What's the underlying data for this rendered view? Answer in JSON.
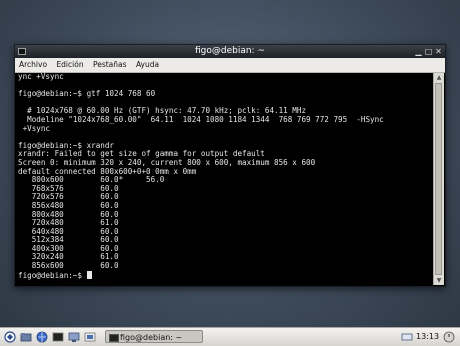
{
  "window": {
    "title": "figo@debian: ~"
  },
  "menubar": {
    "items": [
      "Archivo",
      "Edición",
      "Pestañas",
      "Ayuda"
    ]
  },
  "terminal": {
    "lines": [
      "ync +Vsync",
      "",
      "figo@debian:~$ gtf 1024 768 60",
      "",
      "  # 1024x768 @ 60.00 Hz (GTF) hsync: 47.70 kHz; pclk: 64.11 MHz",
      "  Modeline \"1024x768_60.00\"  64.11  1024 1080 1184 1344  768 769 772 795  -HSync",
      " +Vsync",
      "",
      "figo@debian:~$ xrandr",
      "xrandr: Failed to get size of gamma for output default",
      "Screen 0: minimum 320 x 240, current 800 x 600, maximum 856 x 600",
      "default connected 800x600+0+0 0mm x 0mm",
      "   800x600        60.0*     56.0",
      "   768x576        60.0",
      "   720x576        60.0",
      "   856x480        60.0",
      "   800x480        60.0",
      "   720x480        61.0",
      "   640x480        60.0",
      "   512x384        60.0",
      "   400x300        60.0",
      "   320x240        61.0",
      "   856x600        60.0"
    ],
    "prompt": "figo@debian:~$ "
  },
  "taskbar": {
    "task_label": "figo@debian: ~",
    "clock": "13:13"
  }
}
